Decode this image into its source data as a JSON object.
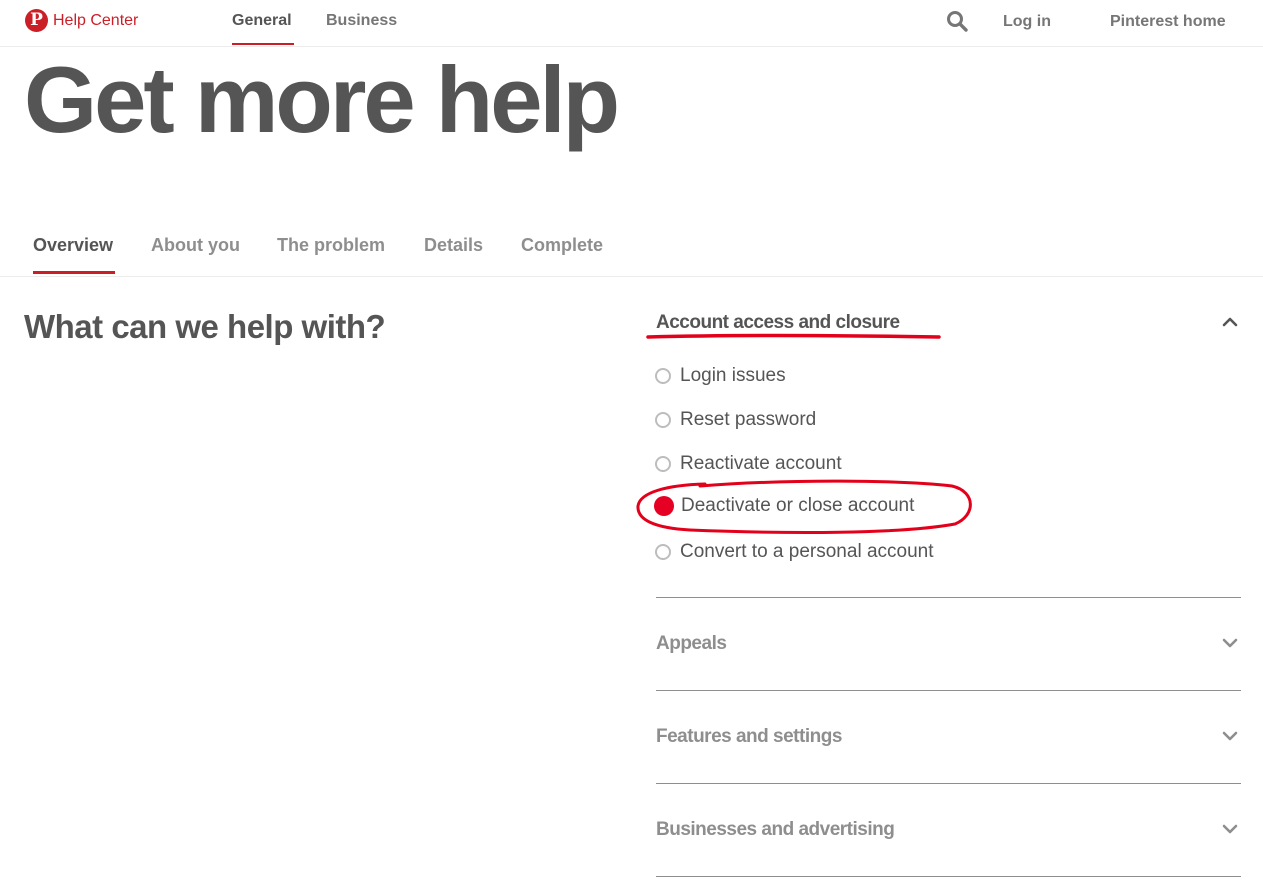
{
  "header": {
    "logo_glyph": "P",
    "brand_label": "Help Center",
    "nav": [
      {
        "label": "General",
        "active": true
      },
      {
        "label": "Business",
        "active": false
      }
    ],
    "login_label": "Log in",
    "home_label": "Pinterest home"
  },
  "hero": {
    "title": "Get more help"
  },
  "steps": [
    {
      "label": "Overview",
      "active": true
    },
    {
      "label": "About you",
      "active": false
    },
    {
      "label": "The problem",
      "active": false
    },
    {
      "label": "Details",
      "active": false
    },
    {
      "label": "Complete",
      "active": false
    }
  ],
  "main": {
    "question": "What can we help with?"
  },
  "categories": {
    "expanded": {
      "title": "Account access and closure",
      "options": [
        {
          "label": "Login issues",
          "selected": false
        },
        {
          "label": "Reset password",
          "selected": false
        },
        {
          "label": "Reactivate account",
          "selected": false
        },
        {
          "label": "Deactivate or close account",
          "selected": true
        },
        {
          "label": "Convert to a personal account",
          "selected": false
        }
      ]
    },
    "collapsed": [
      {
        "title": "Appeals"
      },
      {
        "title": "Features and settings"
      },
      {
        "title": "Businesses and advertising"
      }
    ]
  },
  "colors": {
    "brand_red": "#cb1f27",
    "selected_radio": "#e60023",
    "annotation_red": "#e3001b",
    "text_dark": "#555555",
    "text_muted": "#8e8e8e"
  },
  "icons": [
    "pinterest-logo-icon",
    "search-icon",
    "chevron-up-icon",
    "chevron-down-icon"
  ]
}
